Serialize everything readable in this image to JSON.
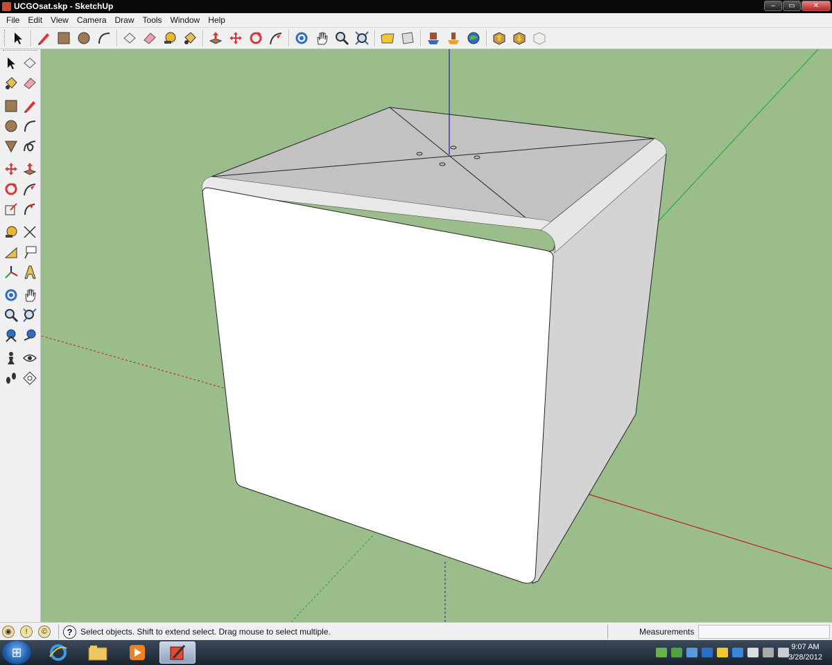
{
  "window": {
    "title": "UCGOsat.skp - SketchUp",
    "buttons": [
      "–",
      "▭",
      "✕"
    ]
  },
  "menu": [
    "File",
    "Edit",
    "View",
    "Camera",
    "Draw",
    "Tools",
    "Window",
    "Help"
  ],
  "toolbar": {
    "tools": [
      {
        "name": "select-tool",
        "icon": "arrow-icon"
      },
      {
        "name": "line-tool",
        "icon": "pencil-icon"
      },
      {
        "name": "rectangle-tool",
        "icon": "rectangle-icon"
      },
      {
        "name": "circle-tool",
        "icon": "circle-icon"
      },
      {
        "name": "arc-tool",
        "icon": "arc-icon"
      },
      {
        "name": "make-component-tool",
        "icon": "component-icon"
      },
      {
        "name": "eraser-tool",
        "icon": "eraser-icon"
      },
      {
        "name": "tape-measure-tool",
        "icon": "tape-icon"
      },
      {
        "name": "paint-bucket-tool",
        "icon": "bucket-icon"
      },
      {
        "name": "push-pull-tool",
        "icon": "pushpull-icon"
      },
      {
        "name": "move-tool",
        "icon": "move-icon"
      },
      {
        "name": "rotate-tool",
        "icon": "rotate-icon"
      },
      {
        "name": "follow-me-tool",
        "icon": "followme-icon"
      },
      {
        "name": "orbit-tool",
        "icon": "orbit-icon"
      },
      {
        "name": "pan-tool",
        "icon": "hand-icon"
      },
      {
        "name": "zoom-tool",
        "icon": "magnifier-icon"
      },
      {
        "name": "zoom-extents-tool",
        "icon": "zoom-extents-icon"
      },
      {
        "name": "previous-view-tool",
        "icon": "folder-icon"
      },
      {
        "name": "next-view-tool",
        "icon": "sheet-icon"
      },
      {
        "name": "get-models-tool",
        "icon": "warehouse-icon"
      },
      {
        "name": "share-model-tool",
        "icon": "share-icon"
      },
      {
        "name": "google-earth-tool",
        "icon": "globe-icon"
      },
      {
        "name": "get-component-tool",
        "icon": "box-down-icon"
      },
      {
        "name": "share-component-tool",
        "icon": "box-up-icon"
      },
      {
        "name": "extension-tool",
        "icon": "box-outline-icon"
      }
    ]
  },
  "status": {
    "message": "Select objects. Shift to extend select. Drag mouse to select multiple.",
    "measurements_label": "Measurements",
    "measurements_value": ""
  },
  "taskbar": {
    "start_icon": "windows-logo-icon",
    "apps": [
      "ie-icon",
      "explorer-icon",
      "media-player-icon",
      "sketchup-icon"
    ],
    "clock_time": "9:07 AM",
    "clock_date": "3/28/2012"
  },
  "colors": {
    "viewport_bg": "#9bbd8c",
    "axis_red": "#c01a1a",
    "axis_green": "#1fa81f",
    "axis_blue": "#1a1aa8",
    "cube_front": "#ffffff",
    "cube_top": "#c4c4c4",
    "cube_side": "#d8d8d8"
  }
}
